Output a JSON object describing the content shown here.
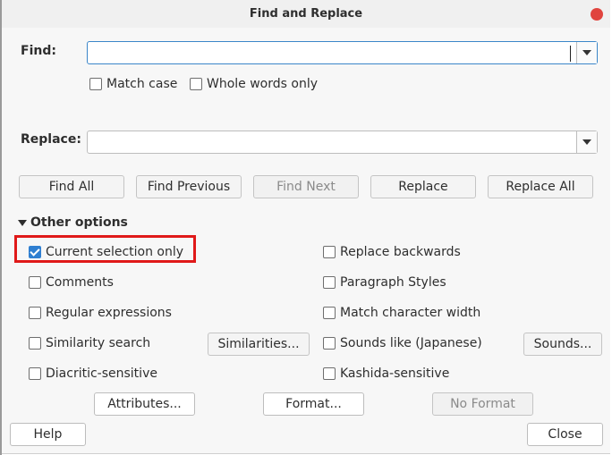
{
  "window": {
    "title": "Find and Replace"
  },
  "find": {
    "label": "Find:",
    "value": "",
    "match_case": "Match case",
    "whole_words": "Whole words only"
  },
  "replace": {
    "label": "Replace:",
    "value": ""
  },
  "actions": {
    "find_all": "Find All",
    "find_previous": "Find Previous",
    "find_next": "Find Next",
    "replace": "Replace",
    "replace_all": "Replace All"
  },
  "other_options": {
    "title": "Other options",
    "current_selection": "Current selection only",
    "comments": "Comments",
    "regex": "Regular expressions",
    "similarity": "Similarity search",
    "similarities_btn": "Similarities...",
    "diacritic": "Diacritic-sensitive",
    "replace_backwards": "Replace backwards",
    "paragraph_styles": "Paragraph Styles",
    "match_width": "Match character width",
    "sounds_like": "Sounds like (Japanese)",
    "sounds_btn": "Sounds...",
    "kashida": "Kashida-sensitive"
  },
  "format_buttons": {
    "attributes": "Attributes...",
    "format": "Format...",
    "no_format": "No Format"
  },
  "footer": {
    "help": "Help",
    "close": "Close"
  },
  "colors": {
    "accent": "#2f7fd1",
    "highlight": "#e01919",
    "close_dot": "#e0443e"
  }
}
